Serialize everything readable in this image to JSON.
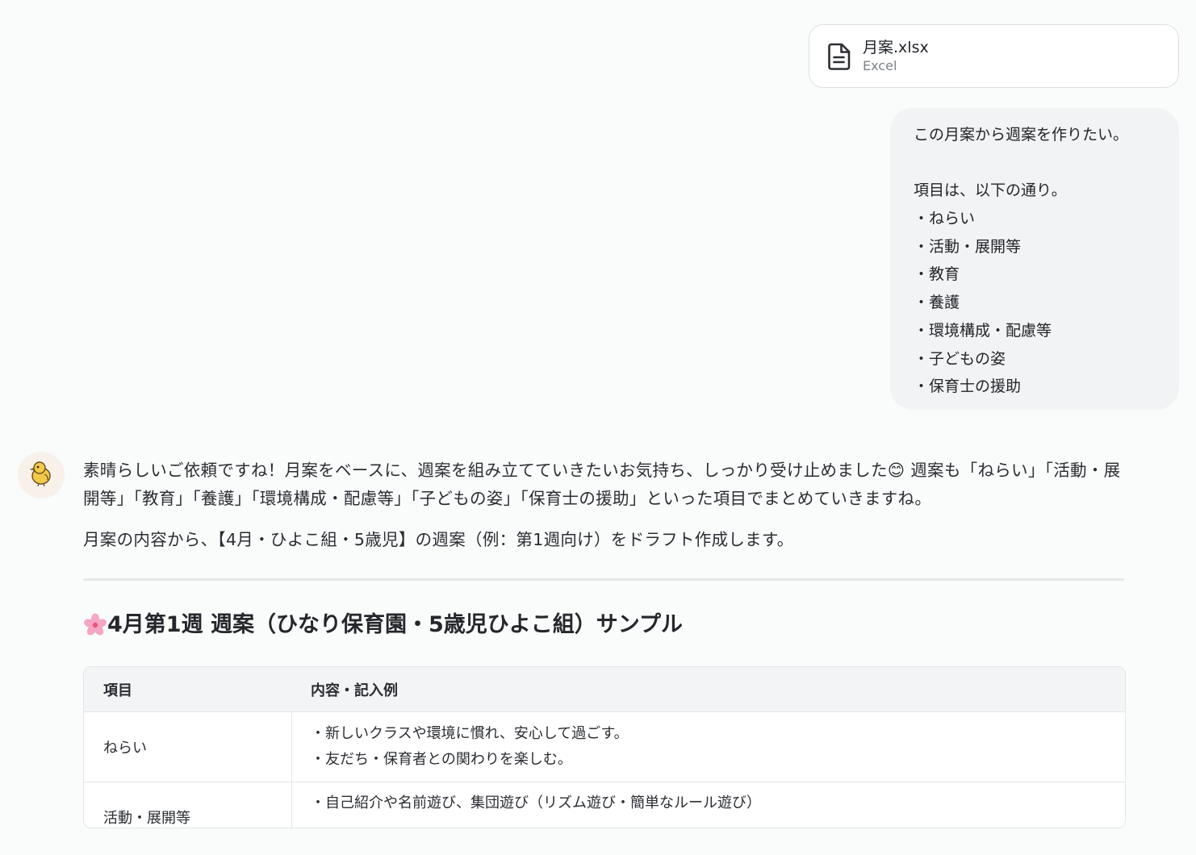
{
  "attachment": {
    "name": "月案.xlsx",
    "type": "Excel",
    "icon": "document-icon"
  },
  "user_message": {
    "lines": [
      "この月案から週案を作りたい。",
      "",
      "項目は、以下の通り。",
      "・ねらい",
      "・活動・展開等",
      "・教育",
      "・養護",
      "・環境構成・配慮等",
      "・子どもの姿",
      "・保育士の援助"
    ]
  },
  "assistant": {
    "avatar_icon": "chick-avatar-icon",
    "paragraph1": "素晴らしいご依頼ですね！月案をベースに、週案を組み立てていきたいお気持ち、しっかり受け止めました😊 週案も「ねらい」「活動・展開等」「教育」「養護」「環境構成・配慮等」「子どもの姿」「保育士の援助」といった項目でまとめていきますね。",
    "paragraph2": "月案の内容から、【4月・ひよこ組・5歳児】の週案（例：第1週向け）をドラフト作成します。",
    "heading_icon": "cherry-blossom-icon",
    "heading": "4月第1週 週案（ひなり保育園・5歳児ひよこ組）サンプル",
    "table": {
      "headers": [
        "項目",
        "内容・記入例"
      ],
      "rows": [
        {
          "item": "ねらい",
          "content": [
            "・新しいクラスや環境に慣れ、安心して過ごす。",
            "・友だち・保育者との関わりを楽しむ。"
          ]
        },
        {
          "item": "活動・展開等",
          "content": [
            "・自己紹介や名前遊び、集団遊び（リズム遊び・簡単なルール遊び）"
          ]
        }
      ]
    }
  }
}
